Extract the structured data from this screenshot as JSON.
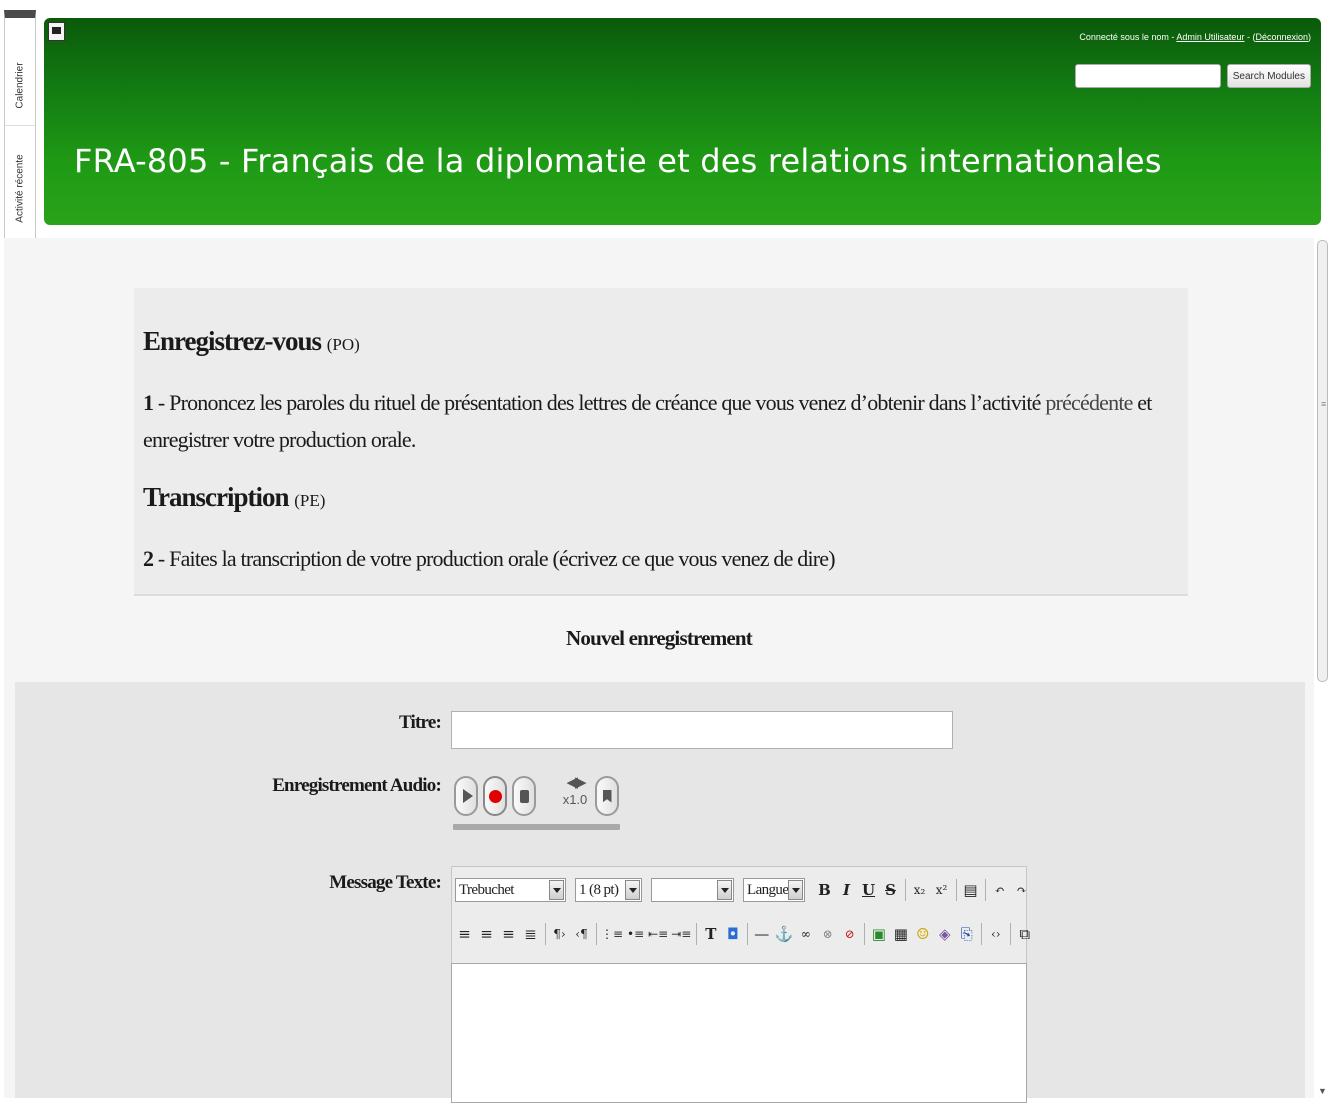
{
  "sidebar": {
    "tabs": [
      {
        "label": "Calendrier"
      },
      {
        "label": "Activité récente"
      }
    ]
  },
  "header": {
    "login_prefix": "Connecté sous le nom - ",
    "user_link": "Admin Utilisateur",
    "separator": " - (",
    "logout_link": "Déconnexion",
    "suffix": ")",
    "search_placeholder": "",
    "search_button": "Search Modules",
    "course_title": "FRA-805 - Français de la diplomatie et des relations internationales",
    "gradient_colors": [
      "#0a5a0a",
      "#2aa31a"
    ]
  },
  "instructions": {
    "heading1": "Enregistrez-vous",
    "heading1_tag": "(PO)",
    "step1_num": "1",
    "step1_text": " - Prononcez les paroles du rituel de présentation des lettres de créance que vous venez d’obtenir dans l’activité ",
    "step1_link": "précédente",
    "step1_text2": " et enregistrer votre production orale.",
    "heading2": "Transcription",
    "heading2_tag": "(PE)",
    "step2_num": "2",
    "step2_text": " - Faites la transcription de votre production orale (écrivez ce que vous venez de dire)"
  },
  "form": {
    "section_title": "Nouvel enregistrement",
    "title_label": "Titre:",
    "title_value": "",
    "audio_label": "Enregistrement Audio:",
    "audio_speed": "x1.0",
    "audio_progress": 1.0,
    "message_label": "Message Texte:",
    "editor": {
      "font_family": "Trebuchet",
      "font_size": "1 (8 pt)",
      "style_value": "",
      "language": "Langue",
      "row1_icons": [
        "bold-icon",
        "italic-icon",
        "underline-icon",
        "strikethrough-icon",
        "subscript-icon",
        "superscript-icon",
        "paste-word-icon",
        "undo-icon",
        "redo-icon"
      ],
      "row2_icons": [
        "align-left-icon",
        "align-center-icon",
        "align-right-icon",
        "justify-icon",
        "ltr-icon",
        "rtl-icon",
        "ordered-list-icon",
        "unordered-list-icon",
        "outdent-icon",
        "indent-icon",
        "text-color-icon",
        "background-color-icon",
        "horizontal-rule-icon",
        "anchor-icon",
        "link-icon",
        "unlink-icon",
        "nolink-icon",
        "image-icon",
        "table-icon",
        "smiley-icon",
        "special-char-icon",
        "search-replace-icon",
        "html-source-icon",
        "fullscreen-icon"
      ],
      "content": ""
    }
  }
}
